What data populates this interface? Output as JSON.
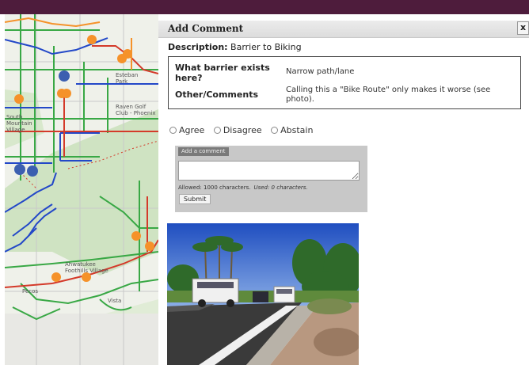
{
  "dialog": {
    "title": "Add Comment",
    "close_label": "x",
    "description_label": "Description:",
    "description_value": "Barrier to Biking",
    "fields": [
      {
        "label": "What barrier exists here?",
        "value": "Narrow path/lane"
      },
      {
        "label": "Other/Comments",
        "value": "Calling this a \"Bike Route\" only makes it worse (see photo)."
      }
    ],
    "vote_options": [
      "Agree",
      "Disagree",
      "Abstain"
    ],
    "comment": {
      "tab_label": "Add a comment",
      "input_value": "",
      "allowed_text": "Allowed: 1000 characters.",
      "used_text": "Used: 0 characters.",
      "submit_label": "Submit"
    }
  },
  "map": {
    "labels": [
      "Esteban Park",
      "Raven Golf Club - Phoenix",
      "South Mountain Village",
      "Ahwatukee Foothills Village",
      "Pecos",
      "Vista"
    ],
    "colors": {
      "header": "#4e1c3c",
      "route_red": "#d43a2a",
      "route_green": "#39a845",
      "route_blue": "#2348c8",
      "marker_orange": "#f5922a",
      "marker_blue": "#3c5fb0"
    }
  }
}
